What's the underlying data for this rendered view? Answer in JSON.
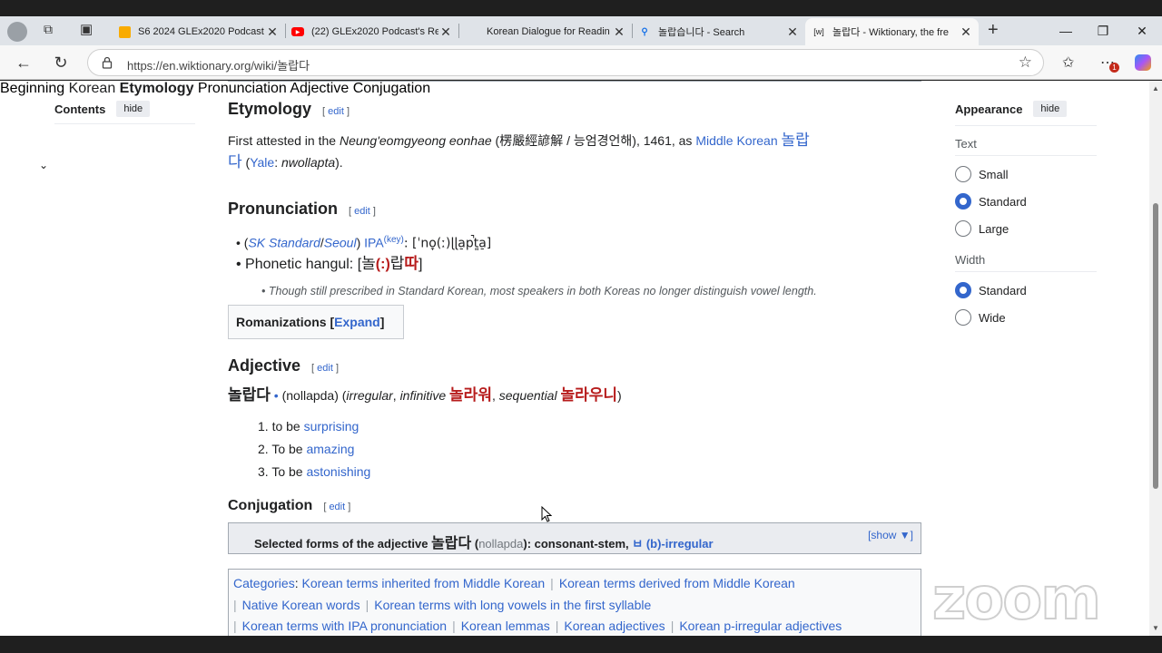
{
  "browser": {
    "tabs": [
      {
        "title": "S6 2024 GLEx2020 Podcast",
        "icon": "slides-icon",
        "color": "#f9ab00"
      },
      {
        "title": "(22) GLEx2020 Podcast's Re",
        "icon": "youtube-icon",
        "color": "#ff0000"
      },
      {
        "title": "Korean Dialogue for Readin",
        "icon": "",
        "color": ""
      },
      {
        "title": "놀랍습니다 - Search",
        "icon": "search-icon",
        "color": "#1a73e8"
      },
      {
        "title": "놀랍다 - Wiktionary, the fre",
        "icon": "wiktionary-icon",
        "color": "#333333"
      }
    ],
    "url": "https://en.wiktionary.org/wiki/놀랍다",
    "wiktionary_favicon": "[w]",
    "badge_count": "1"
  },
  "toc": {
    "title": "Contents",
    "hide_label": "hide",
    "items": [
      "Beginning",
      "Korean",
      "Etymology",
      "Pronunciation",
      "Adjective",
      "Conjugation"
    ]
  },
  "etymology": {
    "heading": "Etymology",
    "edit_label": "edit",
    "text_1": "First attested in the ",
    "work": "Neung'eomgyeong eonhae",
    "text_2": " (楞嚴經諺解 / 능엄경언해), 1461, as ",
    "link_mk": "Middle Korean",
    "mk_word_1": "놀랍",
    "mk_word_2": "다",
    "text_3": " (",
    "link_yale": "Yale",
    "text_4": ": ",
    "yale_form": "nwollapta",
    "text_5": ")."
  },
  "pronunciation": {
    "heading": "Pronunciation",
    "edit_label": "edit",
    "item1_open": "(",
    "sk_standard": "SK Standard",
    "slash": "/",
    "seoul": "Seoul",
    "item1_close": ") ",
    "ipa": "IPA",
    "key": "(key)",
    "ipa_value": ": [ˈno̞(ː)ɭɭa̠p̚t͈a̠]",
    "hangul_label": "Phonetic hangul: [",
    "hangul_1": "놀",
    "hangul_2": "(:)",
    "hangul_3": "랍",
    "hangul_4": "따",
    "hangul_close": "]",
    "note": "Though still prescribed in Standard Korean, most speakers in both Koreas no longer distinguish vowel length."
  },
  "romanizations": {
    "label": "Romanizations",
    "bracket_open": "[",
    "expand": "Expand",
    "bracket_close": "]"
  },
  "adjective": {
    "heading": "Adjective",
    "edit_label": "edit",
    "headword": "놀랍다",
    "dot": " •",
    "romanization": " (nollapda) (",
    "irregular": "irregular",
    "sep1": ", ",
    "infinitive": "infinitive",
    "inf_form": "놀라워",
    "sep2": ", ",
    "sequential": "sequential",
    "seq_form": "놀라우니",
    "close": ")",
    "senses": [
      {
        "num": "1.",
        "prefix": "to be ",
        "link": "surprising"
      },
      {
        "num": "2.",
        "prefix": "To be ",
        "link": "amazing"
      },
      {
        "num": "3.",
        "prefix": "To be ",
        "link": "astonishing"
      }
    ]
  },
  "conjugation": {
    "heading": "Conjugation",
    "edit_label": "edit",
    "box_text_1": "Selected forms of the adjective ",
    "box_word": "놀랍다",
    "box_text_2": " (",
    "box_rom": "nollapda",
    "box_text_3": "): consonant-stem, ",
    "box_link": "ㅂ (b)-irregular",
    "show": "[show ▼]"
  },
  "categories": {
    "label": "Categories",
    "items": [
      "Korean terms inherited from Middle Korean",
      "Korean terms derived from Middle Korean",
      "Native Korean words",
      "Korean terms with long vowels in the first syllable",
      "Korean terms with IPA pronunciation",
      "Korean lemmas",
      "Korean adjectives",
      "Korean p-irregular adjectives"
    ]
  },
  "appearance": {
    "title": "Appearance",
    "hide_label": "hide",
    "text_label": "Text",
    "text_options": [
      "Small",
      "Standard",
      "Large"
    ],
    "text_selected": "Standard",
    "width_label": "Width",
    "width_options": [
      "Standard",
      "Wide"
    ],
    "width_selected": "Standard"
  },
  "watermark": "zoom"
}
